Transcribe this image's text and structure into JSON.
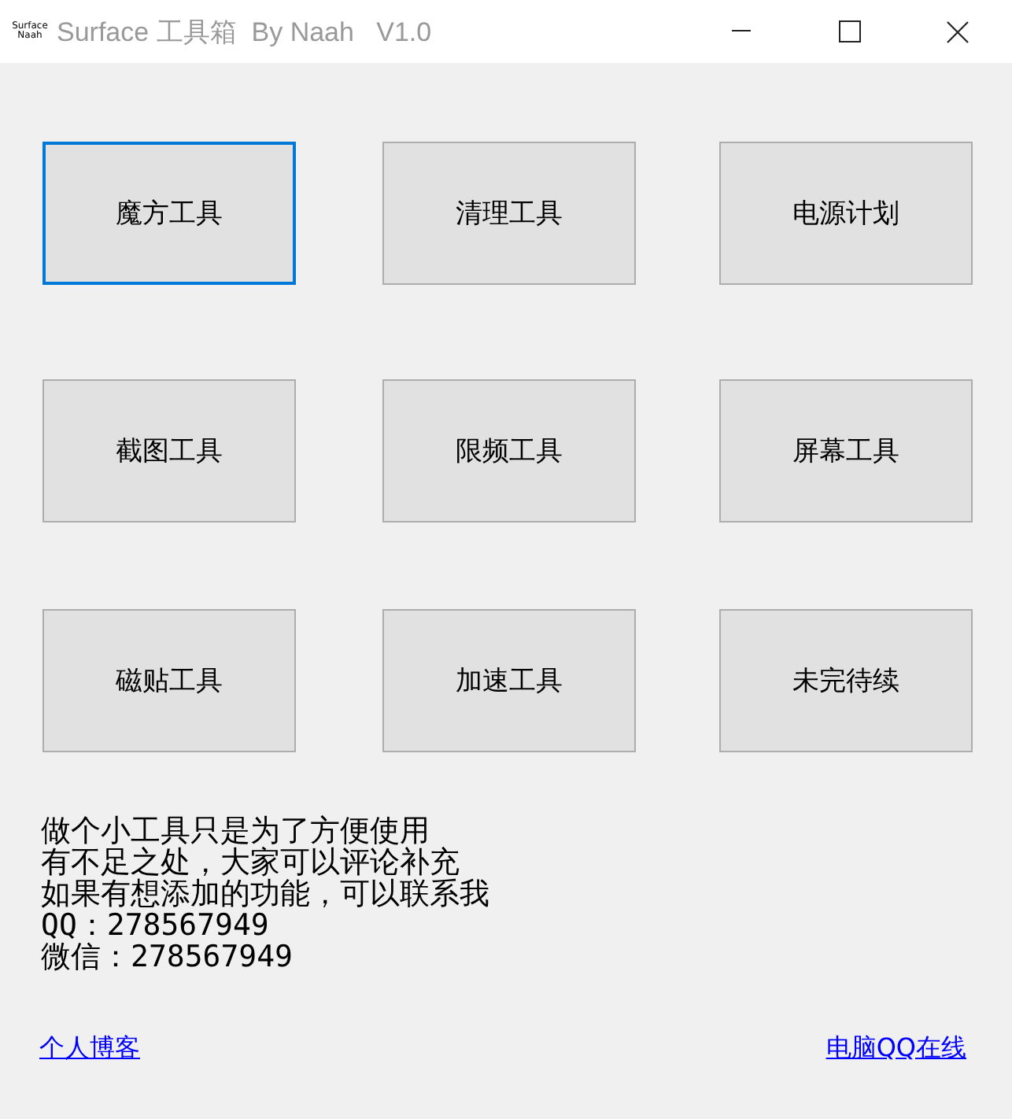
{
  "window": {
    "icon_lines": [
      "Surface",
      "Naah"
    ],
    "title": "Surface 工具箱  By Naah   V1.0"
  },
  "buttons": [
    {
      "label": "魔方工具",
      "focused": true
    },
    {
      "label": "清理工具",
      "focused": false
    },
    {
      "label": "电源计划",
      "focused": false
    },
    {
      "label": "截图工具",
      "focused": false
    },
    {
      "label": "限频工具",
      "focused": false
    },
    {
      "label": "屏幕工具",
      "focused": false
    },
    {
      "label": "磁贴工具",
      "focused": false
    },
    {
      "label": "加速工具",
      "focused": false
    },
    {
      "label": "未完待续",
      "focused": false
    }
  ],
  "info_lines": [
    "做个小工具只是为了方便使用",
    "有不足之处，大家可以评论补充",
    "如果有想添加的功能，可以联系我",
    "QQ：278567949",
    "微信：278567949"
  ],
  "links": [
    "个人博客",
    "电脑QQ在线"
  ]
}
